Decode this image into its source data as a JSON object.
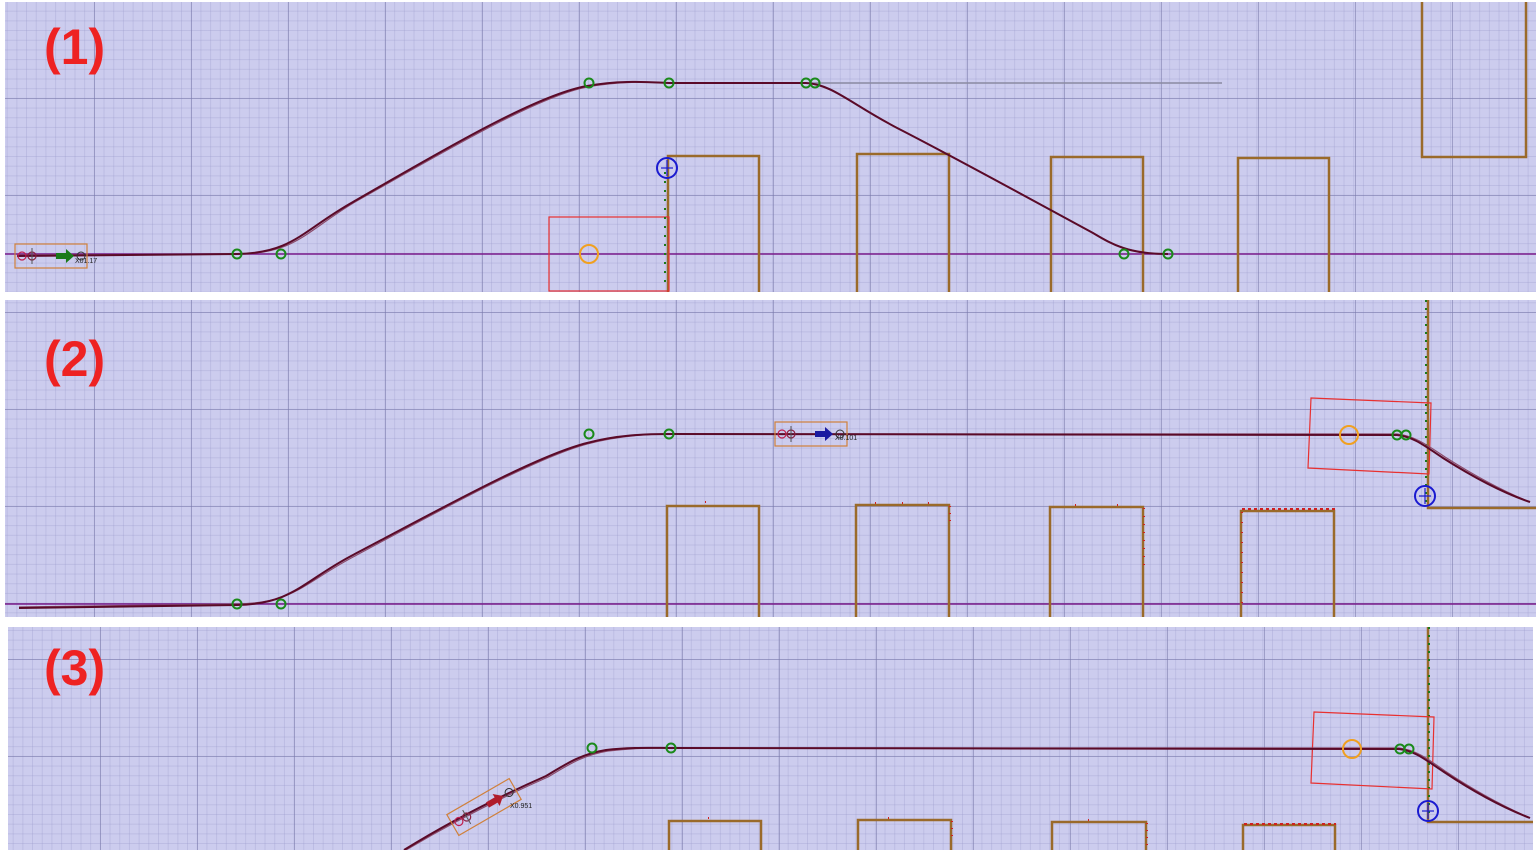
{
  "panels": [
    {
      "label": "(1)",
      "vehicle_tag": "X01.17",
      "arrow_color": "#1a7a1a"
    },
    {
      "label": "(2)",
      "vehicle_tag": "X0.101",
      "arrow_color": "#1a1aa0"
    },
    {
      "label": "(3)",
      "vehicle_tag": "X0.951",
      "arrow_color": "#b01c2c"
    }
  ],
  "colors": {
    "background": "#ccccee",
    "path": "#5a0a28",
    "reference_line": "#7a1a8a",
    "obstacle": "#9a6a2a",
    "waypoint": "#1a8a1a",
    "target_marker": "#f0a020",
    "goal_marker": "#1a1ad0",
    "detection_box": "#e83030",
    "label": "#ee2222"
  }
}
